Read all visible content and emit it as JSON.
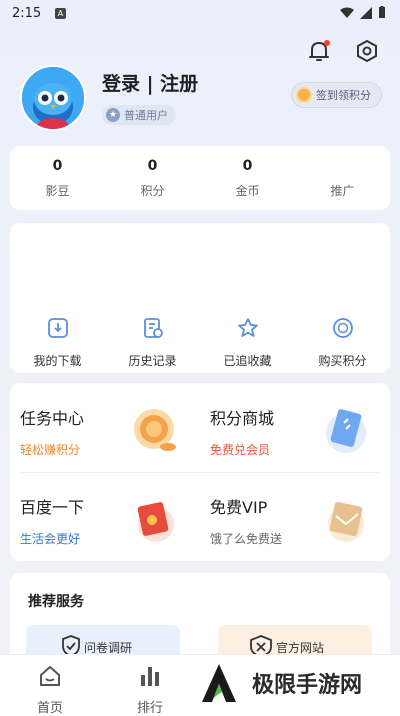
{
  "status_bar": {
    "time": "2:15",
    "notif_badge": "A"
  },
  "profile": {
    "login_label": "登录 | 注册",
    "user_level": "普通用户",
    "signin_button": "签到领积分"
  },
  "stats": [
    {
      "value": "0",
      "label": "影豆"
    },
    {
      "value": "0",
      "label": "积分"
    },
    {
      "value": "0",
      "label": "金币"
    },
    {
      "value": "",
      "label": "推广"
    }
  ],
  "tools": [
    {
      "label": "我的下载",
      "icon": "download-icon"
    },
    {
      "label": "历史记录",
      "icon": "history-icon"
    },
    {
      "label": "已追收藏",
      "icon": "star-icon"
    },
    {
      "label": "购买积分",
      "icon": "coin-icon"
    }
  ],
  "grid": [
    {
      "title": "任务中心",
      "subtitle": "轻松赚积分",
      "subtitle_color": "#f0892a"
    },
    {
      "title": "积分商城",
      "subtitle": "免费兑会员",
      "subtitle_color": "#e2573a"
    },
    {
      "title": "百度一下",
      "subtitle": "生活会更好",
      "subtitle_color": "#2e7bd6"
    },
    {
      "title": "免费VIP",
      "subtitle": "饿了么免费送",
      "subtitle_color": "#666666"
    }
  ],
  "recommend": {
    "title": "推荐服务",
    "items": [
      {
        "label": "问卷调研"
      },
      {
        "label": "官方网站"
      }
    ]
  },
  "tab_bar": [
    {
      "label": "首页",
      "icon": "home-icon"
    },
    {
      "label": "排行",
      "icon": "ranking-icon"
    }
  ],
  "watermark": {
    "text": "极限手游网"
  },
  "colors": {
    "accent": "#2e7bd6",
    "background": "#eef1f8"
  }
}
